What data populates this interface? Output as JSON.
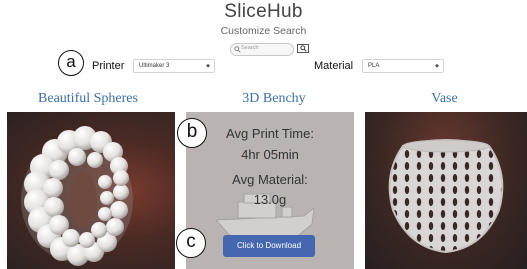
{
  "header": {
    "brand": "SliceHub",
    "subtitle": "Customize Search"
  },
  "search": {
    "placeholder": "Search"
  },
  "filters": {
    "printer_label": "Printer",
    "printer_value": "Ultimaker 3",
    "material_label": "Material",
    "material_value": "PLA"
  },
  "annotations": {
    "a": "a",
    "b": "b",
    "c": "c"
  },
  "cards": [
    {
      "title": "Beautiful Spheres"
    },
    {
      "title": "3D Benchy",
      "print_time_label": "Avg Print Time:",
      "print_time_value": "4hr 05min",
      "material_label": "Avg Material:",
      "material_value": "13.0g",
      "download_label": "Click to Download"
    },
    {
      "title": "Vase"
    }
  ],
  "colors": {
    "title_blue": "#3b6fb3",
    "button_blue": "#4467b0",
    "overlay_gray": "#b9b3b1"
  },
  "icons": [
    "search-icon",
    "chevron-down-icon"
  ]
}
